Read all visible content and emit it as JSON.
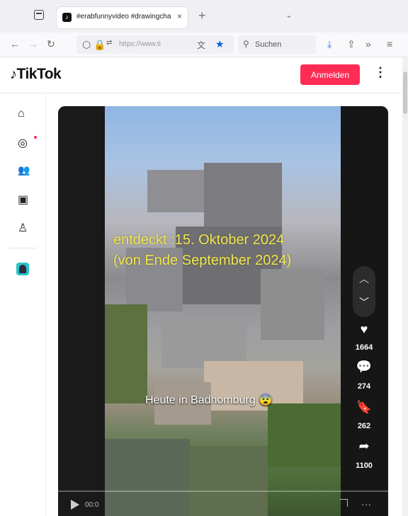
{
  "browser": {
    "tab_title": "#erabfunnyvideo #drawingcha",
    "tab_close": "×",
    "new_tab": "+",
    "url": "https://www.ti",
    "search_placeholder": "Suchen"
  },
  "header": {
    "logo_text": "TikTok",
    "login_label": "Anmelden"
  },
  "video": {
    "overlay_line1": "entdeckt :15. Oktober 2024",
    "overlay_line2": "(von Ende September 2024)",
    "caption": "Heute in Badhomburg 😨",
    "likes": "1664",
    "comments": "274",
    "saves": "262",
    "shares": "1100",
    "time": "00:0"
  },
  "icons": {
    "home": "house-icon",
    "explore": "compass-icon",
    "following": "people-icon",
    "live": "live-camera-icon",
    "profile": "person-icon",
    "app": "app-icon"
  },
  "colors": {
    "accent": "#fe2c55",
    "overlay_text": "#f2e64a"
  }
}
